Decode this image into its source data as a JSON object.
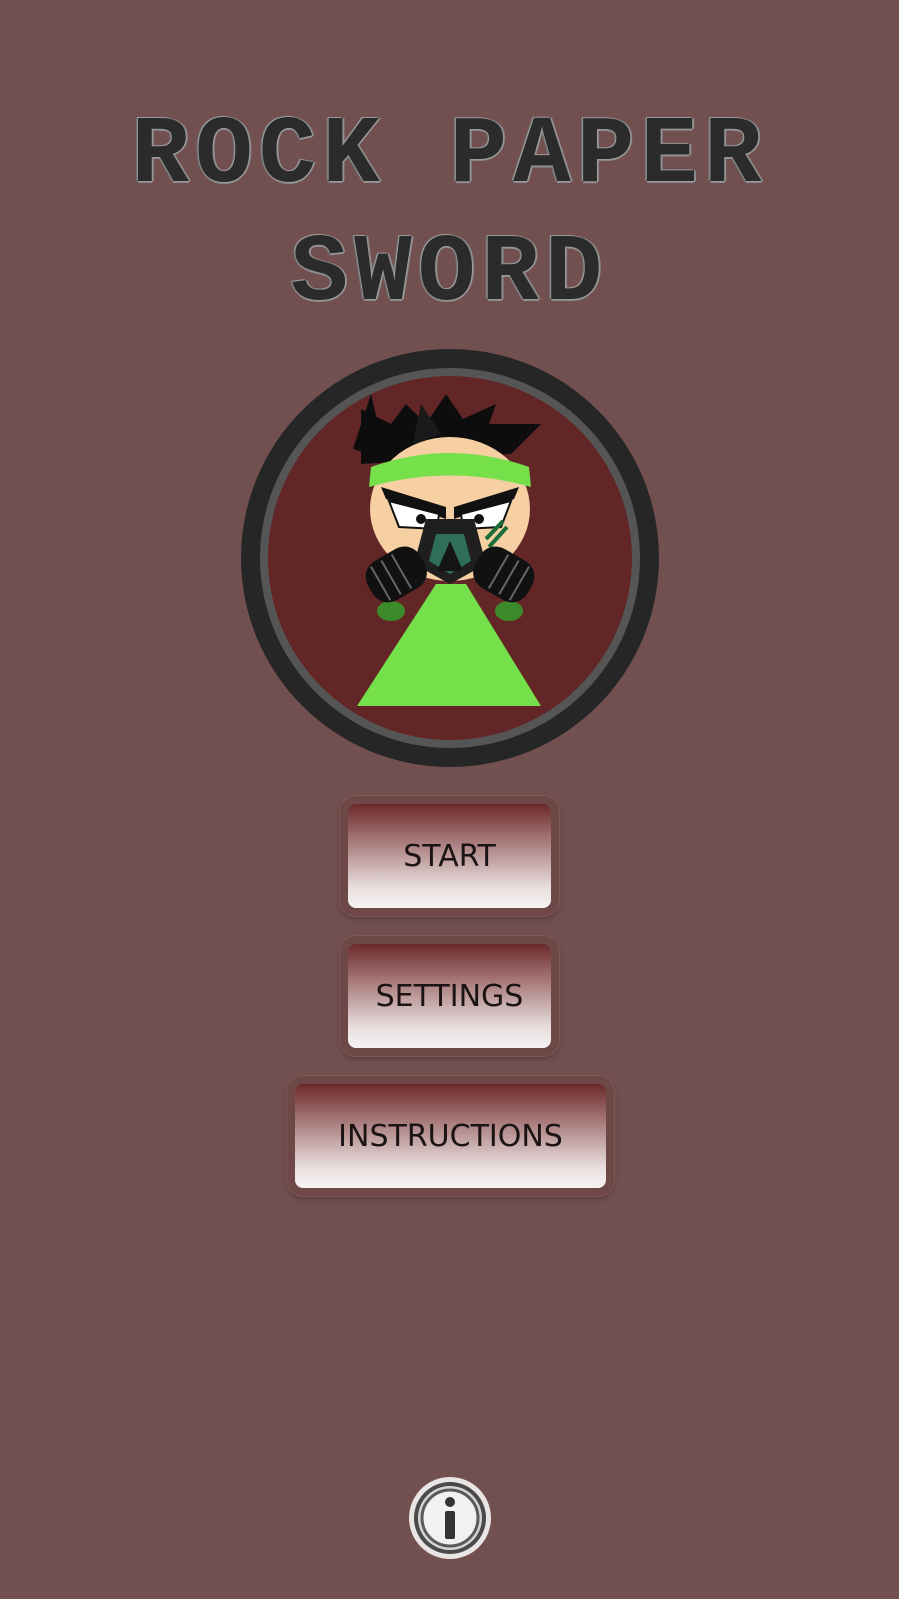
{
  "title": {
    "line1": "ROCK PAPER",
    "line2": "SWORD"
  },
  "menu": {
    "start_label": "START",
    "settings_label": "SETTINGS",
    "instructions_label": "INSTRUCTIONS"
  },
  "info": {
    "icon": "info-icon"
  },
  "colors": {
    "background": "#735050",
    "avatar_bg": "#632626",
    "avatar_green": "#76e04a"
  }
}
